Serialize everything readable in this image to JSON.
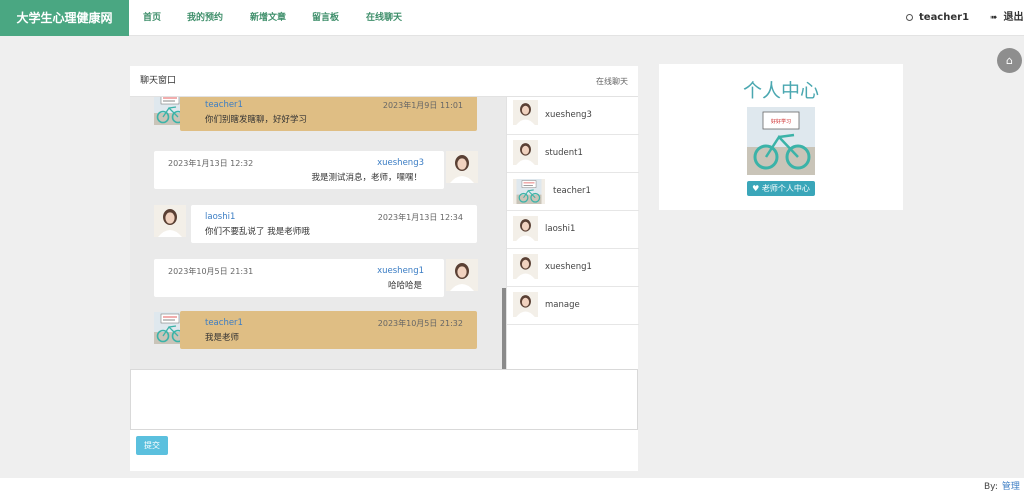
{
  "navbar": {
    "brand": "大学生心理健康网",
    "links": [
      "首页",
      "我的预约",
      "新增文章",
      "留言板",
      "在线聊天"
    ],
    "user": "teacher1",
    "logout": "退出"
  },
  "chat": {
    "title": "聊天窗口",
    "online_label": "在线聊天",
    "messages": [
      {
        "user": "teacher1",
        "time": "2023年1月9日 11:01",
        "text": "你们别瞎发瞎聊，好好学习"
      },
      {
        "user": "xuesheng3",
        "time": "2023年1月13日 12:32",
        "text": "我是测试消息，老师，嘿嘿！"
      },
      {
        "user": "laoshi1",
        "time": "2023年1月13日 12:34",
        "text": "你们不要乱说了 我是老师哦"
      },
      {
        "user": "xuesheng1",
        "time": "2023年10月5日 21:31",
        "text": "哈哈哈是"
      },
      {
        "user": "teacher1",
        "time": "2023年10月5日 21:32",
        "text": "我是老师"
      }
    ],
    "contacts": [
      "xuesheng3",
      "student1",
      "teacher1",
      "laoshi1",
      "xuesheng1",
      "manage"
    ],
    "submit": "提交"
  },
  "profile": {
    "title": "个人中心",
    "button": "老师个人中心",
    "sign_text": "好好学习"
  },
  "footer": {
    "by_label": "By:",
    "by_link": "管理"
  },
  "colors": {
    "brand": "#4aa782",
    "teacher_bubble": "#dfbe84",
    "username": "#3b7dc4",
    "profile_button": "#3aa6b9",
    "submit_button": "#5bc0de"
  },
  "icons": {
    "user": "user-circle-icon",
    "logout": "logout-icon",
    "home": "home-icon",
    "heart": "heart-icon"
  }
}
